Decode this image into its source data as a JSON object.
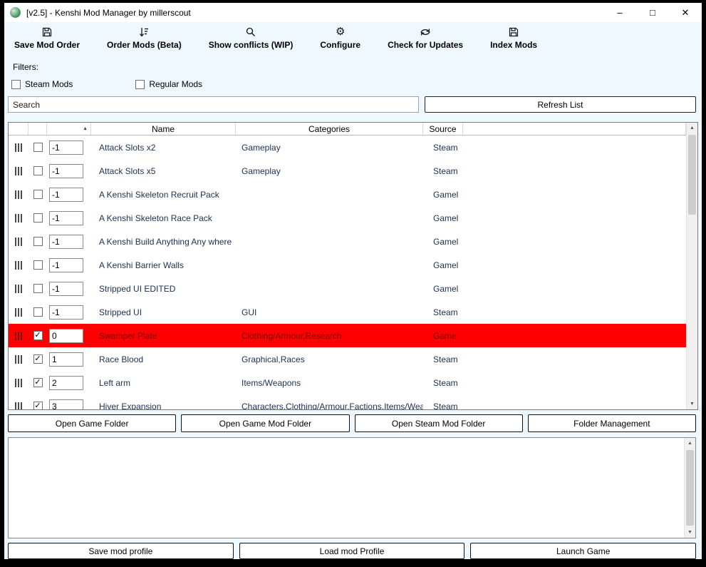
{
  "window": {
    "title": "[v2.5] - Kenshi Mod Manager by millerscout",
    "minimize_glyph": "–",
    "maximize_glyph": "□",
    "close_glyph": "✕"
  },
  "toolbar": {
    "items": [
      {
        "label": "Save Mod Order",
        "icon": "save-icon"
      },
      {
        "label": "Order Mods (Beta)",
        "icon": "sort-order-icon"
      },
      {
        "label": "Show conflicts (WIP)",
        "icon": "search-icon"
      },
      {
        "label": "Configure",
        "icon": "gear-icon"
      },
      {
        "label": "Check for Updates",
        "icon": "refresh-icon"
      },
      {
        "label": "Index Mods",
        "icon": "save-icon"
      }
    ]
  },
  "filters": {
    "label": "Filters:",
    "checkboxes": [
      {
        "label": "Steam Mods",
        "checked": false
      },
      {
        "label": "Regular Mods",
        "checked": false
      }
    ]
  },
  "search": {
    "placeholder": "Search",
    "refresh_button": "Refresh List"
  },
  "table": {
    "sort_indicator": "▲",
    "check_glyph": "✓",
    "headers": {
      "name": "Name",
      "categories": "Categories",
      "source": "Source"
    },
    "rows": [
      {
        "checked": false,
        "order": "-1",
        "name": "Attack Slots x2",
        "categories": "Gameplay",
        "source": "Steam",
        "selected": false
      },
      {
        "checked": false,
        "order": "-1",
        "name": "Attack Slots x5",
        "categories": "Gameplay",
        "source": "Steam",
        "selected": false
      },
      {
        "checked": false,
        "order": "-1",
        "name": "A Kenshi Skeleton Recruit Pack",
        "categories": "",
        "source": "Gamel",
        "selected": false
      },
      {
        "checked": false,
        "order": "-1",
        "name": "A Kenshi Skeleton Race Pack",
        "categories": "",
        "source": "Gamel",
        "selected": false
      },
      {
        "checked": false,
        "order": "-1",
        "name": "A Kenshi Build Anything Any where",
        "categories": "",
        "source": "Gamel",
        "selected": false
      },
      {
        "checked": false,
        "order": "-1",
        "name": "A Kenshi Barrier Walls",
        "categories": "",
        "source": "Gamel",
        "selected": false
      },
      {
        "checked": false,
        "order": "-1",
        "name": "Stripped UI EDITED",
        "categories": "",
        "source": "Gamel",
        "selected": false
      },
      {
        "checked": false,
        "order": "-1",
        "name": "Stripped UI",
        "categories": "GUI",
        "source": "Steam",
        "selected": false
      },
      {
        "checked": true,
        "order": "0",
        "name": "Swamper Plate",
        "categories": "Clothing/Armour,Research",
        "source": "Game",
        "selected": true
      },
      {
        "checked": true,
        "order": "1",
        "name": "Race Blood",
        "categories": "Graphical,Races",
        "source": "Steam",
        "selected": false
      },
      {
        "checked": true,
        "order": "2",
        "name": "Left arm",
        "categories": "Items/Weapons",
        "source": "Steam",
        "selected": false
      },
      {
        "checked": true,
        "order": "3",
        "name": "Hiver Expansion",
        "categories": "Characters,Clothing/Armour,Factions,Items/Wea",
        "source": "Steam",
        "selected": false
      }
    ]
  },
  "folder_buttons": [
    "Open Game Folder",
    "Open Game Mod Folder",
    "Open Steam Mod Folder",
    "Folder Management"
  ],
  "profile_buttons": [
    "Save mod profile",
    "Load mod Profile",
    "Launch Game"
  ],
  "icons": {
    "gear_glyph": "⚙",
    "scroll_up_glyph": "▲",
    "scroll_down_glyph": "▼"
  },
  "colors": {
    "window_bg": "#f0f8ff",
    "titlebar_bg": "#ffffff",
    "selected_row_bg": "#ff0000",
    "selected_row_text": "#7a0000",
    "row_text": "#1b3054"
  }
}
